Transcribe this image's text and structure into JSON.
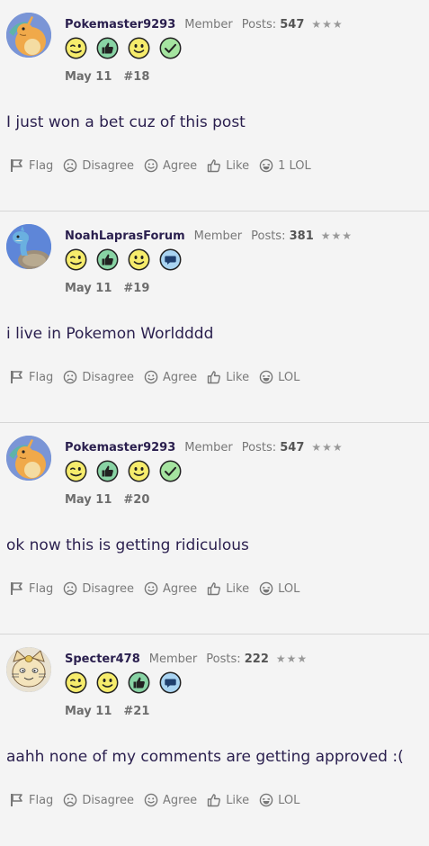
{
  "actions": {
    "flag": "Flag",
    "disagree": "Disagree",
    "agree": "Agree",
    "like": "Like"
  },
  "posts": [
    {
      "username": "Pokemaster9293",
      "role": "Member",
      "posts_label": "Posts:",
      "posts_count": "547",
      "stars": "★★★",
      "avatar": "dragonite-avatar",
      "badges": [
        "wink-badge",
        "thumbs-up-badge",
        "smile-badge",
        "checkmark-badge"
      ],
      "date": "May 11",
      "number": "#18",
      "text": "I just won a bet cuz of this post",
      "lol_label": "1 LOL"
    },
    {
      "username": "NoahLaprasForum",
      "role": "Member",
      "posts_label": "Posts:",
      "posts_count": "381",
      "stars": "★★★",
      "avatar": "lapras-avatar",
      "badges": [
        "wink-badge",
        "thumbs-up-badge",
        "smile-badge",
        "speech-bubble-badge"
      ],
      "date": "May 11",
      "number": "#19",
      "text": "i live in Pokemon Worldddd",
      "lol_label": "LOL"
    },
    {
      "username": "Pokemaster9293",
      "role": "Member",
      "posts_label": "Posts:",
      "posts_count": "547",
      "stars": "★★★",
      "avatar": "dragonite-avatar",
      "badges": [
        "wink-badge",
        "thumbs-up-badge",
        "smile-badge",
        "checkmark-badge"
      ],
      "date": "May 11",
      "number": "#20",
      "text": "ok now this is getting ridiculous",
      "lol_label": "LOL"
    },
    {
      "username": "Specter478",
      "role": "Member",
      "posts_label": "Posts:",
      "posts_count": "222",
      "stars": "★★★",
      "avatar": "meowth-avatar",
      "badges": [
        "wink-badge",
        "smile-badge",
        "thumbs-up-badge",
        "speech-bubble-badge"
      ],
      "date": "May 11",
      "number": "#21",
      "text": "aahh none of my comments are getting approved :(",
      "lol_label": "LOL"
    }
  ]
}
